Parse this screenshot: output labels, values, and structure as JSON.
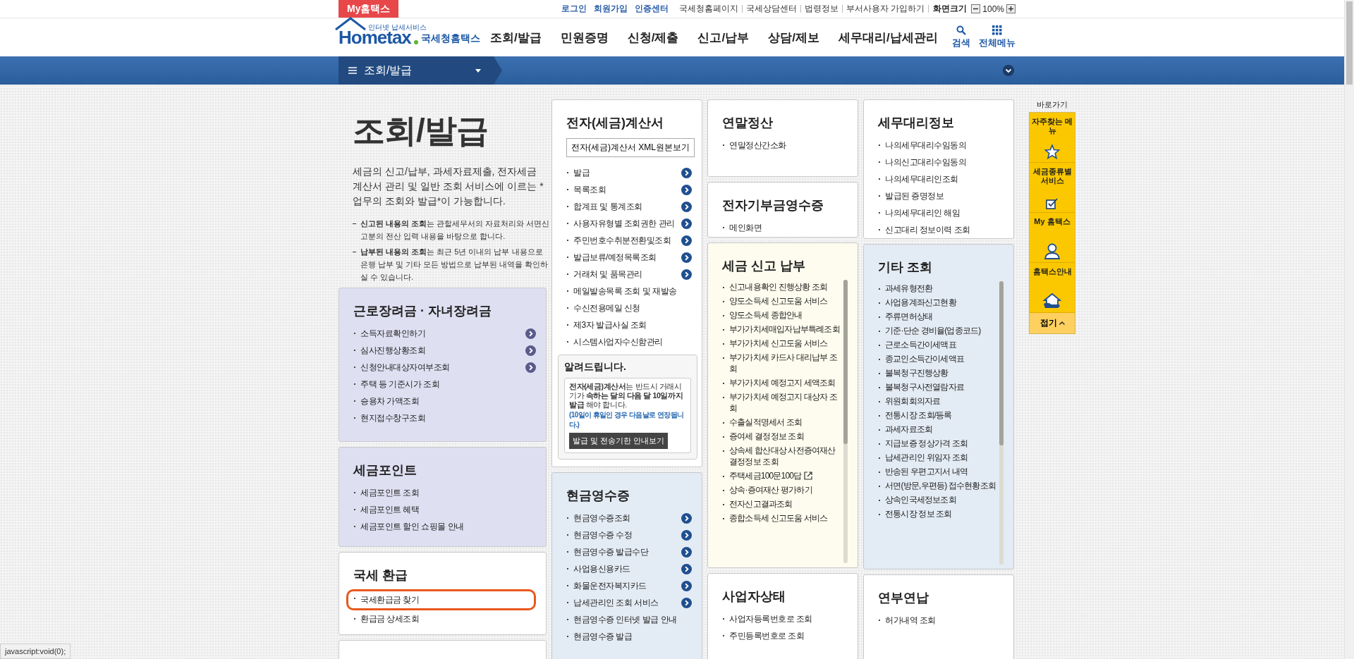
{
  "top_bar": {
    "my_tab": "My홈택스",
    "auth_links": [
      "로그인",
      "회원가입",
      "인증센터"
    ],
    "links": [
      "국세청홈페이지",
      "국세상담센터",
      "법령정보",
      "부서사용자 가입하기"
    ],
    "zoom_label": "화면크기",
    "zoom_value": "100%"
  },
  "header": {
    "logo": {
      "wordmark": "Hometax",
      "tagline": "인터넷 납세서비스",
      "name": "국세청홈택스"
    },
    "menu": [
      "조회/발급",
      "민원증명",
      "신청/제출",
      "신고/납부",
      "상담/제보",
      "세무대리/납세관리"
    ],
    "tools": [
      {
        "kind": "search",
        "label": "검색"
      },
      {
        "kind": "grid",
        "label": "전체메뉴"
      }
    ]
  },
  "nav": {
    "section": "조회/발급"
  },
  "intro": {
    "title": "조회/발급",
    "description": "세금의 신고/납부, 과세자료제출, 전자세금계산서 관리 및 일반 조회 서비스에 이르는 *업무의 조회와 발급*이 가능합니다.",
    "notes": [
      "**신고된 내용의 조회**는 관할세무서의 자료처리와 서면신고분의 전산 입력 내용을 바탕으로 합니다.",
      "**납부된 내용의 조회**는 최근 5년 이내의 납부 내용으로 은행 납부 및 기타 모든 방법으로 납부된 내역을 확인하실 수 있습니다."
    ]
  },
  "columns": [
    {
      "cards": [
        {
          "title": "근로장려금 · 자녀장려금",
          "kind": "list",
          "color": "#dfdff2",
          "items": [
            {
              "label": "소득자료확인하기",
              "arrow": true,
              "highlighted": false
            },
            {
              "label": "심사진행상황조회",
              "arrow": true,
              "highlighted": false
            },
            {
              "label": "신청안내대상자여부조회",
              "arrow": true,
              "highlighted": false
            },
            {
              "label": "주택 등 기준시가 조회",
              "arrow": false,
              "highlighted": false
            },
            {
              "label": "승용차 가액조회",
              "arrow": false,
              "highlighted": false
            },
            {
              "label": "현지접수창구조회",
              "arrow": false,
              "highlighted": false
            }
          ]
        },
        {
          "title": "세금포인트",
          "kind": "list",
          "color": "#dfdff2",
          "items": [
            {
              "label": "세금포인트 조회",
              "highlighted": false
            },
            {
              "label": "세금포인트 혜택",
              "highlighted": false
            },
            {
              "label": "세금포인트 할인 쇼핑몰 안내",
              "highlighted": false
            }
          ]
        },
        {
          "title": "국세 환급",
          "kind": "list",
          "color": "#ffffff",
          "items": [
            {
              "label": "국세환급금 찾기",
              "highlighted": true
            },
            {
              "label": "환급금 상세조회",
              "highlighted": false
            }
          ]
        },
        {
          "kind": "list",
          "color": "#ffffff"
        }
      ]
    },
    {
      "cards": [
        {
          "title": "전자(세금)계산서",
          "kind": "list",
          "color": "#ffffff",
          "button": "전자(세금)계산서 XML원본보기",
          "items": [
            {
              "label": "발급",
              "arrow": true
            },
            {
              "label": "목록조회",
              "arrow": true
            },
            {
              "label": "합계표 및 통계조회",
              "arrow": true
            },
            {
              "label": "사용자유형별 조회권한 관리",
              "arrow": true
            },
            {
              "label": "주민번호수취분전환및조회",
              "arrow": true
            },
            {
              "label": "발급보류/예정목록조회",
              "arrow": true
            },
            {
              "label": "거래처 및 품목관리",
              "arrow": true
            },
            {
              "label": "메일발송목록 조회 및 재발송",
              "arrow": false
            },
            {
              "label": "수신전용메일 신청",
              "arrow": false
            },
            {
              "label": "제3자 발급사실 조회",
              "arrow": false
            },
            {
              "label": "시스템사업자수신함관리",
              "arrow": false
            }
          ],
          "notice": {
            "title": "알려드립니다.",
            "text": "**전자(세금)계산서**는 반드시 거래시기가 **속하는 달의 다음 달 10일까지 발급** 해야 합니다.",
            "note": "(10일이 휴일인 경우 다음날로 연장됩니다.)",
            "button": "발급 및 전송기한 안내보기"
          }
        },
        {
          "title": "현금영수증",
          "kind": "list",
          "color": "#e3ebf4",
          "items": [
            {
              "label": "현금영수증조회",
              "arrow": true
            },
            {
              "label": "현금영수증 수정",
              "arrow": true
            },
            {
              "label": "현금영수증 발급수단",
              "arrow": true
            },
            {
              "label": "사업용신용카드",
              "arrow": true
            },
            {
              "label": "화물운전자복지카드",
              "arrow": true
            },
            {
              "label": "납세관리인 조회 서비스",
              "arrow": true
            },
            {
              "label": "현금영수증 인터넷 발급 안내",
              "arrow": false
            },
            {
              "label": "현금영수증 발급",
              "arrow": false
            }
          ]
        }
      ]
    },
    {
      "cards": [
        {
          "title": "연말정산",
          "kind": "list",
          "color": "#ffffff",
          "items": [
            {
              "label": "연말정산간소화"
            }
          ]
        },
        {
          "title": "전자기부금영수증",
          "kind": "list",
          "color": "#ffffff",
          "items": [
            {
              "label": "메인화면"
            }
          ]
        },
        {
          "title": "세금 신고 납부",
          "kind": "scroll",
          "color": "#fdfcee",
          "items": [
            {
              "label": "신고내용확인 진행상황 조회"
            },
            {
              "label": "양도소득세 신고도움 서비스"
            },
            {
              "label": "양도소득세 종합안내"
            },
            {
              "label": "부가가치세매입자납부특례조회"
            },
            {
              "label": "부가가치세 신고도움 서비스"
            },
            {
              "label": "부가가치세 카드사 대리납부 조회"
            },
            {
              "label": "부가가치세 예정고지 세액조회"
            },
            {
              "label": "부가가치세 예정고지 대상자 조회"
            },
            {
              "label": "수출실적명세서 조회"
            },
            {
              "label": "증여세 결정정보 조회"
            },
            {
              "label": "상속세 합산대상 사전증여재산 결정정보 조회"
            },
            {
              "label": "주택세금100문100답",
              "external": true
            },
            {
              "label": "상속·증여재산 평가하기"
            },
            {
              "label": "전자신고결과조회"
            },
            {
              "label": "종합소득세 신고도움 서비스"
            }
          ]
        },
        {
          "title": "사업자상태",
          "kind": "list",
          "color": "#ffffff",
          "items": [
            {
              "label": "사업자등록번호로 조회"
            },
            {
              "label": "주민등록번호로 조회"
            }
          ]
        }
      ]
    },
    {
      "cards": [
        {
          "title": "세무대리정보",
          "kind": "list",
          "color": "#ffffff",
          "items": [
            {
              "label": "나의세무대리수임동의"
            },
            {
              "label": "나의신고대리수임동의"
            },
            {
              "label": "나의세무대리인조회"
            },
            {
              "label": "발급된 증명정보"
            },
            {
              "label": "나의세무대리인 해임"
            },
            {
              "label": "신고대리 정보이력 조회"
            }
          ]
        },
        {
          "title": "기타 조회",
          "kind": "scroll",
          "color": "#e3ebf4",
          "items": [
            {
              "label": "과세유형전환"
            },
            {
              "label": "사업용계좌신고현황"
            },
            {
              "label": "주류면허상태"
            },
            {
              "label": "기준·단순 경비율(업종코드)"
            },
            {
              "label": "근로소득간이세액표"
            },
            {
              "label": "종교인소득간이세액표"
            },
            {
              "label": "불복청구진행상황"
            },
            {
              "label": "불복청구사전열람자료"
            },
            {
              "label": "위원회회의자료"
            },
            {
              "label": "전통시장 조회/등록"
            },
            {
              "label": "과세자료조회"
            },
            {
              "label": "지급보증 정상가격 조회"
            },
            {
              "label": "납세관리인 위임자 조회"
            },
            {
              "label": "반송된 우편고지서 내역"
            },
            {
              "label": "서면(방문,우편등) 접수현황조회"
            },
            {
              "label": "상속인국세정보조회"
            },
            {
              "label": "전통시장 정보 조회"
            }
          ]
        },
        {
          "title": "연부연납",
          "kind": "list",
          "color": "#ffffff",
          "items": [
            {
              "label": "허가내역 조회"
            }
          ]
        }
      ]
    }
  ],
  "quick_bar": {
    "title": "바로가기",
    "items": [
      {
        "label": "자주찾는 메뉴"
      },
      {
        "label": "세금종류별 서비스"
      },
      {
        "label": "My 홈택스"
      },
      {
        "label": "홈택스안내"
      }
    ],
    "collapse": "접기"
  },
  "status_bar": "javascript:void(0);"
}
